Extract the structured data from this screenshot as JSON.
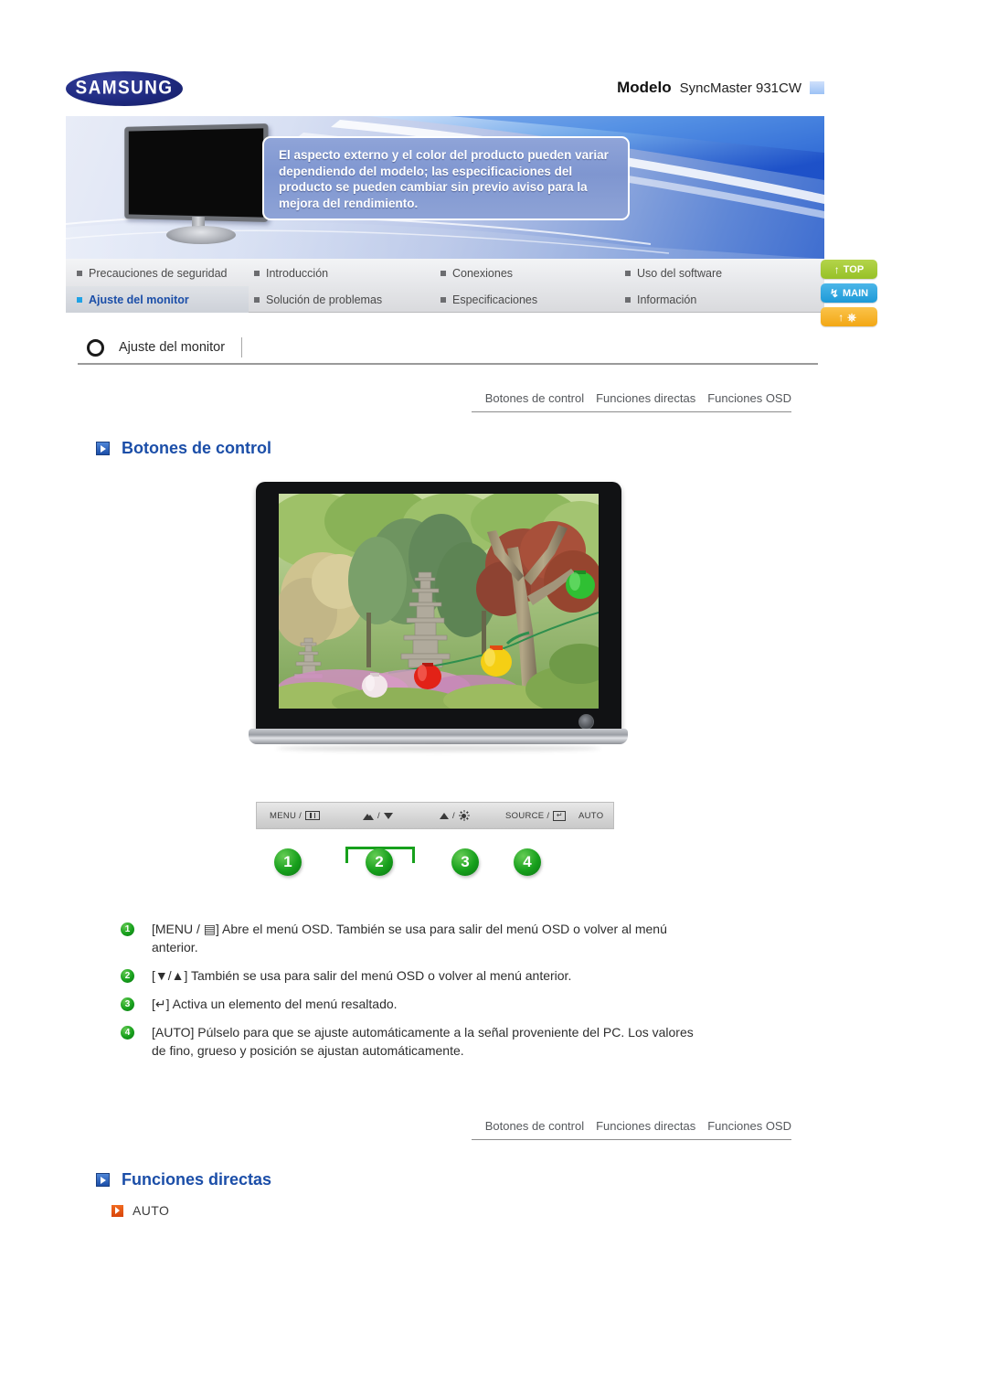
{
  "header": {
    "logo_text": "SAMSUNG",
    "logo_name": "samsung-logo",
    "model_label": "Modelo",
    "model_value": "SyncMaster 931CW"
  },
  "hero": {
    "note": "El aspecto externo y el color del producto pueden variar dependiendo del modelo; las especificaciones del producto se pueden cambiar sin previo aviso para la mejora del rendimiento."
  },
  "nav": {
    "items": [
      {
        "label": "Precauciones de seguridad",
        "active": false
      },
      {
        "label": "Introducción",
        "active": false
      },
      {
        "label": "Conexiones",
        "active": false
      },
      {
        "label": "Uso del software",
        "active": false
      },
      {
        "label": "Ajuste del monitor",
        "active": true
      },
      {
        "label": "Solución de problemas",
        "active": false
      },
      {
        "label": "Especificaciones",
        "active": false
      },
      {
        "label": "Información",
        "active": false
      }
    ]
  },
  "side_buttons": [
    {
      "label": "TOP",
      "icon": "up-arrow-icon",
      "color": "#97c128"
    },
    {
      "label": "MAIN",
      "icon": "home-arrow-icon",
      "color": "#1d9ad8"
    },
    {
      "label": "",
      "icon": "up-arrow-book-icon",
      "color": "#f2a715"
    }
  ],
  "section": {
    "title": "Ajuste del monitor"
  },
  "subnav": {
    "links": [
      "Botones de control",
      "Funciones directas",
      "Funciones OSD"
    ]
  },
  "headings": {
    "botones_de_control": "Botones de control",
    "funciones_directas": "Funciones directas"
  },
  "direct_functions": {
    "items": [
      {
        "label": "AUTO"
      }
    ]
  },
  "control_bar": {
    "buttons": [
      {
        "label": "MENU /",
        "icon": "menu-grid-icon"
      },
      {
        "label": "/",
        "icon": "contrast-icon",
        "icon2": "down-arrow-icon"
      },
      {
        "label": "/",
        "icon": "up-arrow-icon",
        "icon2": "brightness-sun-icon"
      },
      {
        "label": "SOURCE /",
        "icon": "enter-icon"
      },
      {
        "label": "AUTO",
        "icon": ""
      }
    ]
  },
  "badges": [
    "1",
    "2",
    "3",
    "4"
  ],
  "descriptions": [
    {
      "num": "1",
      "text": "[MENU / ▤] Abre el menú OSD. También se usa para salir del menú OSD o volver al menú anterior."
    },
    {
      "num": "2",
      "text": "[▼/▲] También se usa para salir del menú OSD o volver al menú anterior."
    },
    {
      "num": "3",
      "text": "[↵] Activa un elemento del menú resaltado."
    },
    {
      "num": "4",
      "text": "[AUTO] Púlselo para que se ajuste automáticamente a la señal proveniente del PC. Los valores de fino, grueso y posición se ajustan automáticamente."
    }
  ],
  "product_photo": {
    "alt": "Monitor mostrando un jardín con pagoda de piedra y faroles"
  }
}
